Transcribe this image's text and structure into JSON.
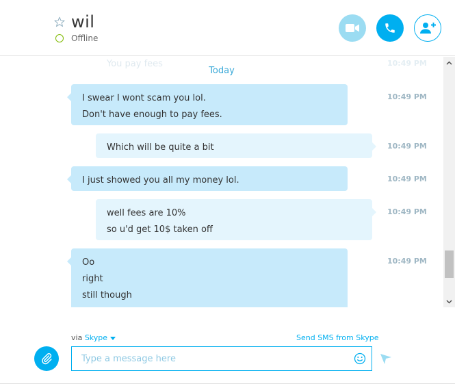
{
  "header": {
    "contact_name": "wil",
    "status": "Offline"
  },
  "conversation": {
    "partial_message": "You pay fees",
    "partial_time": "10:49 PM",
    "day_separator": "Today",
    "messages": [
      {
        "direction": "incoming",
        "lines": [
          "I swear I wont scam you lol.",
          "Don't have enough to pay fees."
        ],
        "time": "10:49 PM"
      },
      {
        "direction": "outgoing",
        "lines": [
          "Which will be quite a bit"
        ],
        "time": "10:49 PM"
      },
      {
        "direction": "incoming",
        "lines": [
          "I just showed you all my money lol."
        ],
        "time": "10:49 PM"
      },
      {
        "direction": "outgoing",
        "lines": [
          "well fees are 10%",
          "so u'd get 10$ taken off"
        ],
        "time": "10:49 PM"
      },
      {
        "direction": "incoming",
        "lines": [
          "Oo",
          "right",
          "still though"
        ],
        "time": "10:49 PM"
      }
    ]
  },
  "compose": {
    "via_label": "via",
    "via_service": "Skype",
    "send_sms_label": "Send SMS from Skype",
    "input_placeholder": "Type a message here",
    "input_value": ""
  },
  "colors": {
    "accent": "#00aff0",
    "incoming_bubble": "#c7eafb",
    "outgoing_bubble": "#e4f5fd",
    "status_offline": "#7fba00"
  },
  "icons": {
    "favorite": "star-outline-icon",
    "video_call": "video-camera-icon",
    "audio_call": "phone-icon",
    "add_people": "add-person-icon",
    "attach": "paperclip-icon",
    "emoji": "smiley-icon",
    "send": "send-arrow-icon"
  }
}
